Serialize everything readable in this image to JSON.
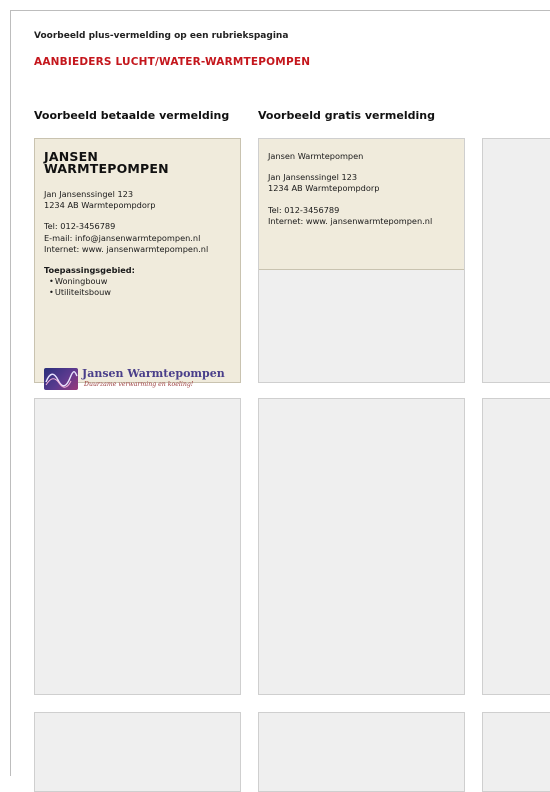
{
  "intro": "Voorbeeld plus-vermelding op een rubriekspagina",
  "category": "AANBIEDERS LUCHT/WATER-WARMTEPOMPEN",
  "columns": {
    "paid": "Voorbeeld betaalde vermelding",
    "free": "Voorbeeld gratis vermelding"
  },
  "paid": {
    "name_line1": "JANSEN",
    "name_line2": "WARMTEPOMPEN",
    "address1": "Jan Jansenssingel 123",
    "address2": "1234 AB Warmtepompdorp",
    "tel": "Tel: 012-3456789",
    "email": "E-mail: info@jansenwarmtepompen.nl",
    "internet": "Internet: www. jansenwarmtepompen.nl",
    "scope_title": "Toepassingsgebied:",
    "scope": [
      "Woningbouw",
      "Utiliteitsbouw"
    ],
    "logo_title": "Jansen Warmtepompen",
    "logo_tagline": "Duurzame verwarming en koeling!"
  },
  "free": {
    "name": "Jansen Warmtepompen",
    "address1": "Jan Jansenssingel 123",
    "address2": "1234 AB Warmtepompdorp",
    "tel": "Tel: 012-3456789",
    "internet": "Internet: www. jansenwarmtepompen.nl"
  },
  "colors": {
    "accent": "#c4161c",
    "highlight_card": "#f0ebdc",
    "empty_card": "#efefef"
  }
}
